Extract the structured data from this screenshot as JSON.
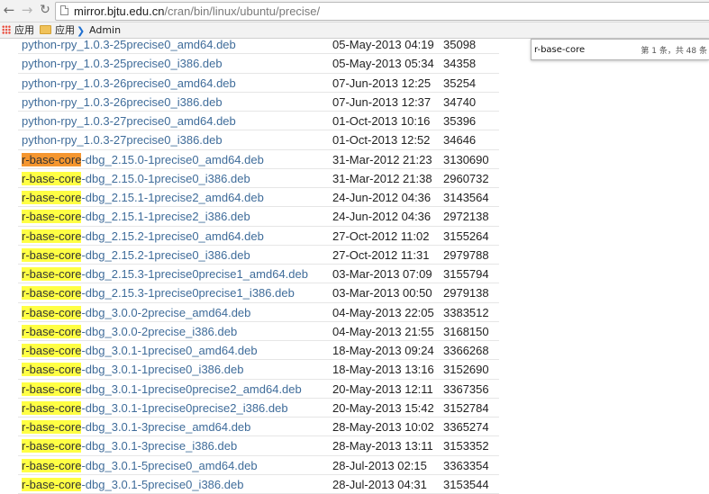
{
  "browser": {
    "icons": {
      "back": "arrow-left-icon",
      "forward": "arrow-right-icon",
      "reload": "reload-icon",
      "page": "page-icon"
    },
    "url_host": "mirror.bjtu.edu.cn",
    "url_path": "/cran/bin/linux/ubuntu/precise/"
  },
  "bookmarks": [
    {
      "label": "应用",
      "icon": "apps-grid-icon"
    },
    {
      "label": "应用",
      "icon": "folder-icon"
    },
    {
      "label": "Admin",
      "icon": "admin-icon"
    }
  ],
  "find": {
    "query": "r-base-core",
    "count": "第 1 条，共 48 条"
  },
  "colors": {
    "link": "#3f6c9a",
    "highlight": "#ffff44",
    "current_highlight": "#f5962f"
  },
  "files": [
    {
      "pre": "",
      "match": "",
      "post": "python-rpy_1.0.3-25precise0_amd64.deb",
      "date": "05-May-2013 04:19",
      "size": "35098"
    },
    {
      "pre": "",
      "match": "",
      "post": "python-rpy_1.0.3-25precise0_i386.deb",
      "date": "05-May-2013 05:34",
      "size": "34358"
    },
    {
      "pre": "",
      "match": "",
      "post": "python-rpy_1.0.3-26precise0_amd64.deb",
      "date": "07-Jun-2013 12:25",
      "size": "35254"
    },
    {
      "pre": "",
      "match": "",
      "post": "python-rpy_1.0.3-26precise0_i386.deb",
      "date": "07-Jun-2013 12:37",
      "size": "34740"
    },
    {
      "pre": "",
      "match": "",
      "post": "python-rpy_1.0.3-27precise0_amd64.deb",
      "date": "01-Oct-2013 10:16",
      "size": "35396"
    },
    {
      "pre": "",
      "match": "",
      "post": "python-rpy_1.0.3-27precise0_i386.deb",
      "date": "01-Oct-2013 12:52",
      "size": "34646"
    },
    {
      "pre": "",
      "match": "r-base-core",
      "current": true,
      "post": "-dbg_2.15.0-1precise0_amd64.deb",
      "date": "31-Mar-2012 21:23",
      "size": "3130690"
    },
    {
      "pre": "",
      "match": "r-base-core",
      "post": "-dbg_2.15.0-1precise0_i386.deb",
      "date": "31-Mar-2012 21:38",
      "size": "2960732"
    },
    {
      "pre": "",
      "match": "r-base-core",
      "post": "-dbg_2.15.1-1precise2_amd64.deb",
      "date": "24-Jun-2012 04:36",
      "size": "3143564"
    },
    {
      "pre": "",
      "match": "r-base-core",
      "post": "-dbg_2.15.1-1precise2_i386.deb",
      "date": "24-Jun-2012 04:36",
      "size": "2972138"
    },
    {
      "pre": "",
      "match": "r-base-core",
      "post": "-dbg_2.15.2-1precise0_amd64.deb",
      "date": "27-Oct-2012 11:02",
      "size": "3155264"
    },
    {
      "pre": "",
      "match": "r-base-core",
      "post": "-dbg_2.15.2-1precise0_i386.deb",
      "date": "27-Oct-2012 11:31",
      "size": "2979788"
    },
    {
      "pre": "",
      "match": "r-base-core",
      "post": "-dbg_2.15.3-1precise0precise1_amd64.deb",
      "date": "03-Mar-2013 07:09",
      "size": "3155794"
    },
    {
      "pre": "",
      "match": "r-base-core",
      "post": "-dbg_2.15.3-1precise0precise1_i386.deb",
      "date": "03-Mar-2013 00:50",
      "size": "2979138"
    },
    {
      "pre": "",
      "match": "r-base-core",
      "post": "-dbg_3.0.0-2precise_amd64.deb",
      "date": "04-May-2013 22:05",
      "size": "3383512"
    },
    {
      "pre": "",
      "match": "r-base-core",
      "post": "-dbg_3.0.0-2precise_i386.deb",
      "date": "04-May-2013 21:55",
      "size": "3168150"
    },
    {
      "pre": "",
      "match": "r-base-core",
      "post": "-dbg_3.0.1-1precise0_amd64.deb",
      "date": "18-May-2013 09:24",
      "size": "3366268"
    },
    {
      "pre": "",
      "match": "r-base-core",
      "post": "-dbg_3.0.1-1precise0_i386.deb",
      "date": "18-May-2013 13:16",
      "size": "3152690"
    },
    {
      "pre": "",
      "match": "r-base-core",
      "post": "-dbg_3.0.1-1precise0precise2_amd64.deb",
      "date": "20-May-2013 12:11",
      "size": "3367356"
    },
    {
      "pre": "",
      "match": "r-base-core",
      "post": "-dbg_3.0.1-1precise0precise2_i386.deb",
      "date": "20-May-2013 15:42",
      "size": "3152784"
    },
    {
      "pre": "",
      "match": "r-base-core",
      "post": "-dbg_3.0.1-3precise_amd64.deb",
      "date": "28-May-2013 10:02",
      "size": "3365274"
    },
    {
      "pre": "",
      "match": "r-base-core",
      "post": "-dbg_3.0.1-3precise_i386.deb",
      "date": "28-May-2013 13:11",
      "size": "3153352"
    },
    {
      "pre": "",
      "match": "r-base-core",
      "post": "-dbg_3.0.1-5precise0_amd64.deb",
      "date": "28-Jul-2013 02:15",
      "size": "3363354"
    },
    {
      "pre": "",
      "match": "r-base-core",
      "post": "-dbg_3.0.1-5precise0_i386.deb",
      "date": "28-Jul-2013 04:31",
      "size": "3153544"
    }
  ]
}
